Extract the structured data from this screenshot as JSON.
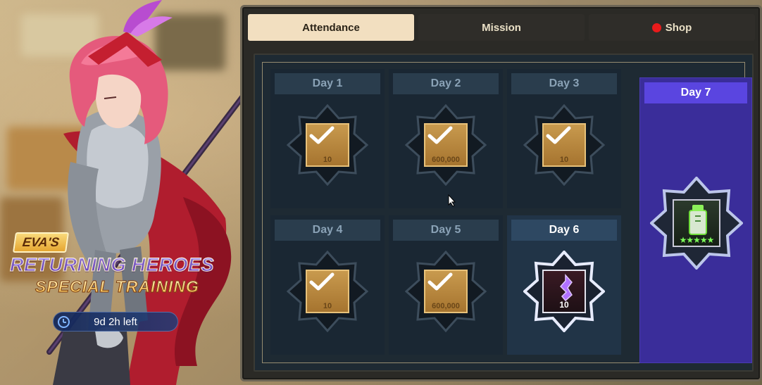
{
  "event": {
    "owner": "EVA'S",
    "title_line1": "RETURNING HEROES",
    "title_line2": "SPECIAL TRAINING",
    "time_left": "9d 2h left"
  },
  "tabs": [
    {
      "label": "Attendance",
      "active": true
    },
    {
      "label": "Mission",
      "active": false
    },
    {
      "label": "Shop",
      "active": false,
      "notification": true
    }
  ],
  "days": [
    {
      "label": "Day 1",
      "quantity": "10",
      "claimed": true
    },
    {
      "label": "Day 2",
      "quantity": "600,000",
      "claimed": true
    },
    {
      "label": "Day 3",
      "quantity": "10",
      "claimed": true
    },
    {
      "label": "Day 4",
      "quantity": "10",
      "claimed": true
    },
    {
      "label": "Day 5",
      "quantity": "600,000",
      "claimed": true
    },
    {
      "label": "Day 6",
      "quantity": "10",
      "claimed": false,
      "current": true
    },
    {
      "label": "Day 7",
      "quantity": "",
      "claimed": false,
      "rating_stars": 5
    }
  ],
  "colors": {
    "active_tab": "#f2dfc0",
    "day7_bg": "#3a2d9a",
    "day7_header": "#5a45e0",
    "reward_gold": "#b8843c",
    "notify_dot": "#e91b1b"
  },
  "icons": {
    "clock": "clock-icon",
    "check": "check-icon",
    "day6_item": "purple-crystal-icon",
    "day7_item": "green-lantern-icon"
  }
}
